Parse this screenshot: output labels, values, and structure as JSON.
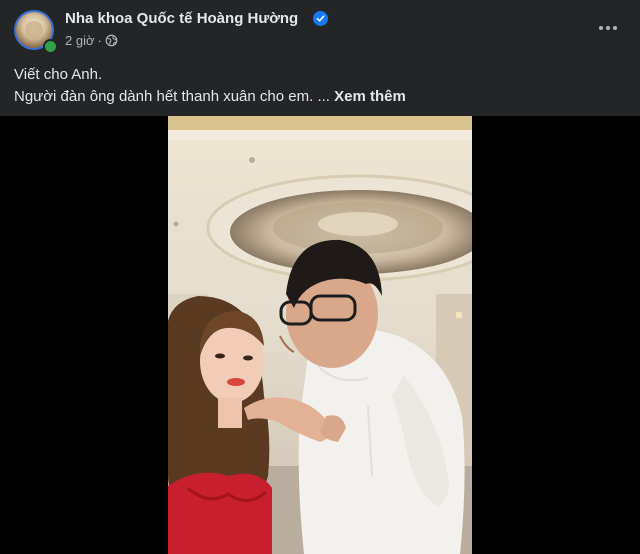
{
  "post": {
    "author": "Nha khoa Quốc tế Hoàng Hường",
    "verified": true,
    "time": "2 giờ",
    "separator": "·",
    "privacy_icon": "globe-icon",
    "more_icon": "more-options-icon",
    "caption_line1": "Viết cho Anh.",
    "caption_line2": "Người đàn ông dành hết thanh xuân cho em.",
    "ellipsis": "...",
    "see_more": "Xem thêm"
  },
  "colors": {
    "background": "#242526",
    "text_primary": "#e4e6eb",
    "text_secondary": "#b0b3b8",
    "verified_badge": "#1877f2",
    "online": "#31a24c",
    "video_letterbox": "#000000"
  }
}
